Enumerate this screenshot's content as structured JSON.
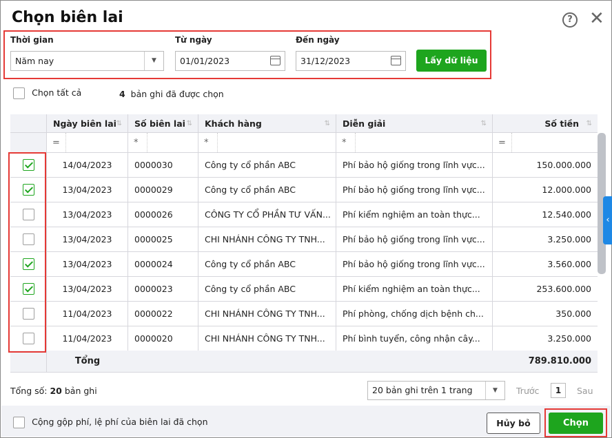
{
  "title": "Chọn biên lai",
  "filter": {
    "period_label": "Thời gian",
    "period_value": "Năm nay",
    "from_label": "Từ ngày",
    "from_value": "01/01/2023",
    "to_label": "Đến ngày",
    "to_value": "31/12/2023",
    "fetch_button": "Lấy dữ liệu"
  },
  "select_all": "Chọn tất cả",
  "selected_count": "4",
  "selected_text": "bản ghi đã được chọn",
  "columns": [
    "Ngày biên lai",
    "Số biên lai",
    "Khách hàng",
    "Diễn giải",
    "Số tiền"
  ],
  "filter_ops": [
    "=",
    "*",
    "*",
    "*",
    "="
  ],
  "rows": [
    {
      "checked": true,
      "date": "14/04/2023",
      "no": "0000030",
      "customer": "Công ty cổ phần ABC",
      "desc": "Phí bảo hộ giống trong lĩnh vực...",
      "amount": "150.000.000"
    },
    {
      "checked": true,
      "date": "13/04/2023",
      "no": "0000029",
      "customer": "Công ty cổ phần ABC",
      "desc": "Phí bảo hộ giống trong lĩnh vực...",
      "amount": "12.000.000"
    },
    {
      "checked": false,
      "date": "13/04/2023",
      "no": "0000026",
      "customer": "CÔNG TY CỔ PHẦN TƯ VẤN...",
      "desc": "Phí kiểm nghiệm an toàn thực...",
      "amount": "12.540.000"
    },
    {
      "checked": false,
      "date": "13/04/2023",
      "no": "0000025",
      "customer": "CHI NHÁNH CÔNG TY TNH...",
      "desc": "Phí bảo hộ giống trong lĩnh vực...",
      "amount": "3.250.000"
    },
    {
      "checked": true,
      "date": "13/04/2023",
      "no": "0000024",
      "customer": "Công ty cổ phần ABC",
      "desc": "Phí bảo hộ giống trong lĩnh vực...",
      "amount": "3.560.000"
    },
    {
      "checked": true,
      "date": "13/04/2023",
      "no": "0000023",
      "customer": "Công ty cổ phần ABC",
      "desc": "Phí kiểm nghiệm an toàn thực...",
      "amount": "253.600.000"
    },
    {
      "checked": false,
      "date": "11/04/2023",
      "no": "0000022",
      "customer": "CHI NHÁNH CÔNG TY TNH...",
      "desc": "Phí phòng, chống dịch bệnh ch...",
      "amount": "350.000"
    },
    {
      "checked": false,
      "date": "11/04/2023",
      "no": "0000020",
      "customer": "CHI NHÁNH CÔNG TY TNH...",
      "desc": "Phí bình tuyển, công nhận cây...",
      "amount": "3.250.000"
    }
  ],
  "total_label": "Tổng",
  "total_amount": "789.810.000",
  "summary_prefix": "Tổng số:",
  "summary_count": "20",
  "summary_suffix": "bản ghi",
  "page_size": "20 bản ghi trên 1 trang",
  "prev": "Trước",
  "page": "1",
  "next": "Sau",
  "merge_label": "Cộng gộp phí, lệ phí của biên lai đã chọn",
  "cancel": "Hủy bỏ",
  "choose": "Chọn"
}
